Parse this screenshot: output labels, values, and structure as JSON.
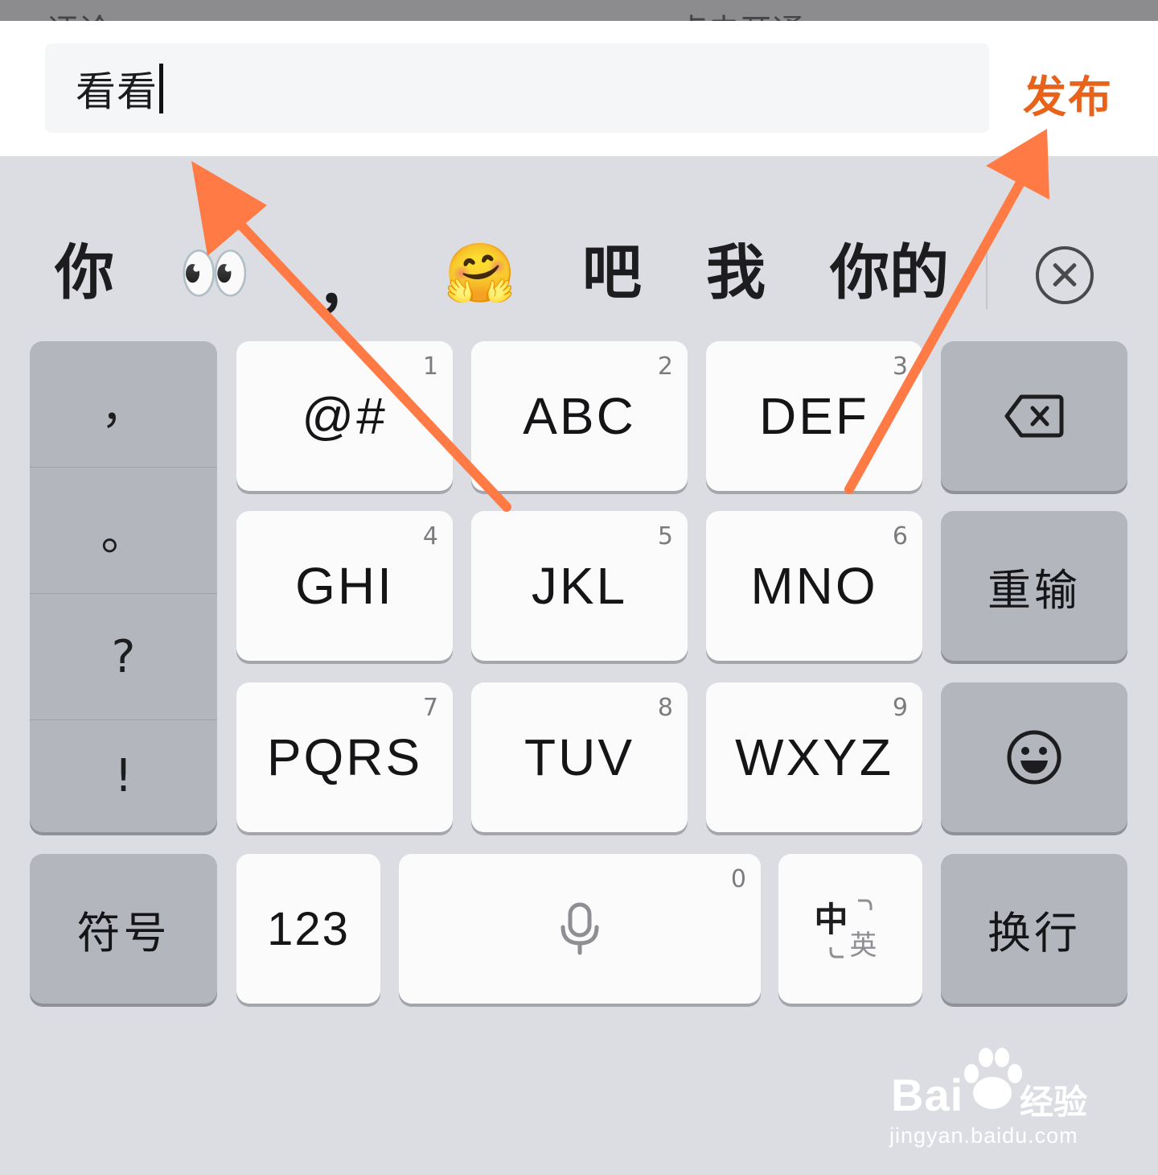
{
  "top_strip": {
    "peek_left": "评论",
    "peek_right": "点击开通"
  },
  "composer": {
    "input_value": "看看",
    "publish_label": "发布"
  },
  "candidates": [
    "你",
    "👀",
    "，",
    "🤗",
    "吧",
    "我",
    "你的"
  ],
  "punctuation": [
    "，",
    "。",
    "?",
    "!"
  ],
  "keys": {
    "k1": {
      "label": "@#",
      "num": "1"
    },
    "k2": {
      "label": "ABC",
      "num": "2"
    },
    "k3": {
      "label": "DEF",
      "num": "3"
    },
    "k4": {
      "label": "GHI",
      "num": "4"
    },
    "k5": {
      "label": "JKL",
      "num": "5"
    },
    "k6": {
      "label": "MNO",
      "num": "6"
    },
    "k7": {
      "label": "PQRS",
      "num": "7"
    },
    "k8": {
      "label": "TUV",
      "num": "8"
    },
    "k9": {
      "label": "WXYZ",
      "num": "9"
    },
    "reinput": "重输",
    "symbols": "符号",
    "numeric": "123",
    "space_num": "0",
    "lang_zh": "中",
    "lang_en": "英",
    "enter": "换行"
  },
  "icons": {
    "clear_candidates": "close-circle-icon",
    "backspace": "backspace-icon",
    "emoji": "smiley-icon",
    "voice": "microphone-icon",
    "language": "language-toggle-icon"
  },
  "colors": {
    "accent": "#e8621a",
    "arrow": "#ff7a45",
    "keyboard_bg": "#dcdde2",
    "dark_key": "#b3b6bd"
  },
  "watermark": {
    "brand": "Bai",
    "brand_cn": "经验",
    "url": "jingyan.baidu.com"
  }
}
